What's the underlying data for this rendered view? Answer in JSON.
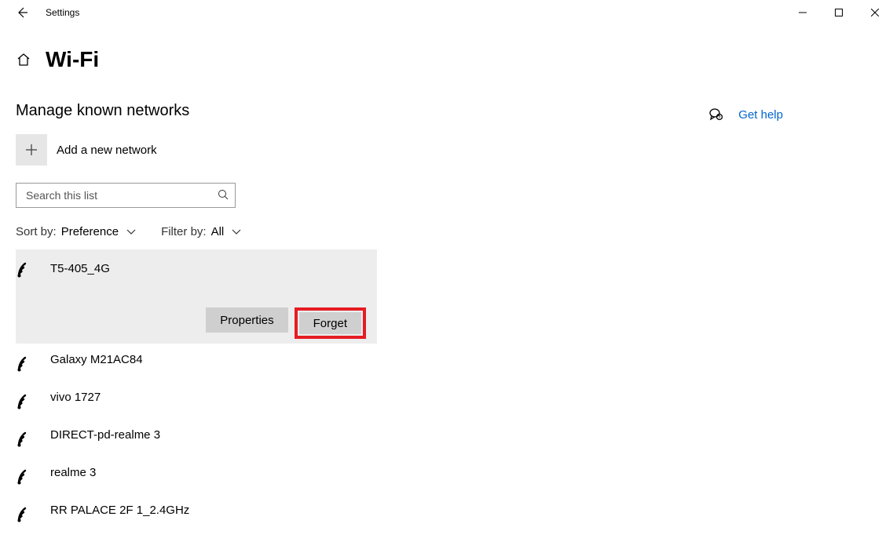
{
  "titlebar": {
    "label": "Settings"
  },
  "page": {
    "title": "Wi-Fi"
  },
  "section": {
    "title": "Manage known networks"
  },
  "add_network": {
    "label": "Add a new network"
  },
  "search": {
    "placeholder": "Search this list"
  },
  "sort": {
    "label": "Sort by:",
    "value": "Preference"
  },
  "filter": {
    "label": "Filter by:",
    "value": "All"
  },
  "help": {
    "label": "Get help"
  },
  "selected_network": {
    "name": "T5-405_4G",
    "properties_label": "Properties",
    "forget_label": "Forget"
  },
  "networks": [
    {
      "name": "Galaxy M21AC84"
    },
    {
      "name": "vivo 1727"
    },
    {
      "name": "DIRECT-pd-realme 3"
    },
    {
      "name": "realme 3"
    },
    {
      "name": "RR PALACE 2F 1_2.4GHz"
    }
  ]
}
